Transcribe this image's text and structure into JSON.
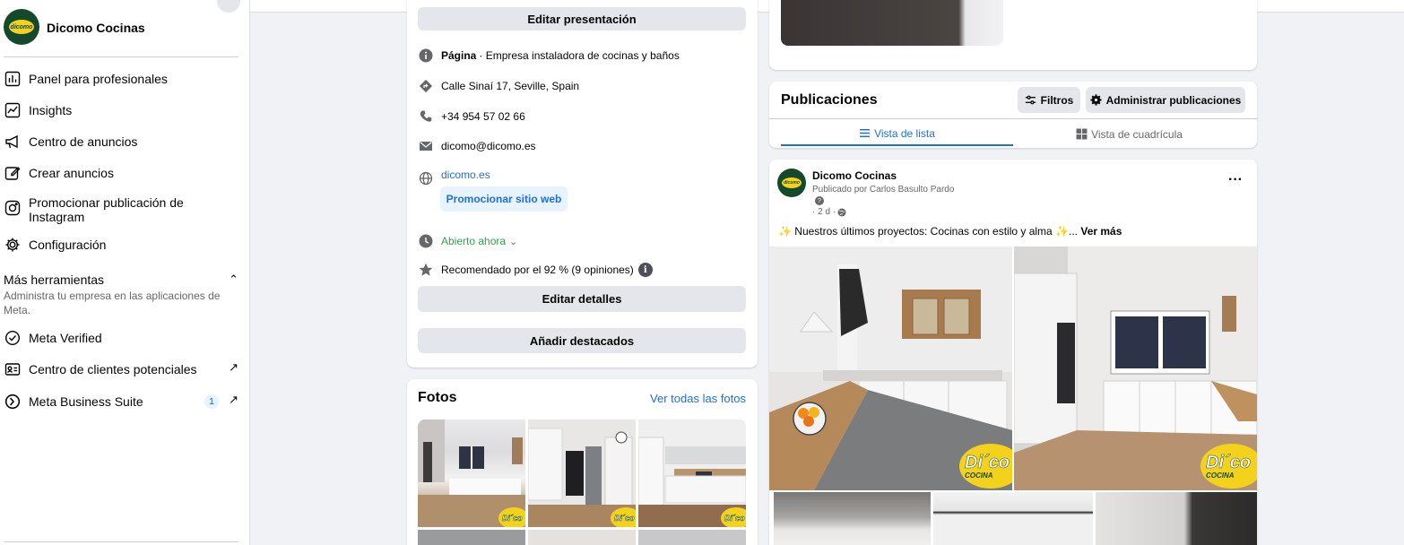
{
  "colors": {
    "accent": "#216fdb",
    "brand_green": "#14492c",
    "brand_yellow": "#f4d21c",
    "open_green": "#31a24c"
  },
  "sidebar": {
    "page_name": "Dicomo Cocinas",
    "items": [
      {
        "label": "Panel para profesionales",
        "icon": "dashboard-icon"
      },
      {
        "label": "Insights",
        "icon": "insights-icon"
      },
      {
        "label": "Centro de anuncios",
        "icon": "megaphone-icon"
      },
      {
        "label": "Crear anuncios",
        "icon": "edit-icon"
      },
      {
        "label": "Promocionar publicación de Instagram",
        "icon": "instagram-icon"
      },
      {
        "label": "Configuración",
        "icon": "gear-icon"
      }
    ],
    "more_tools": {
      "title": "Más herramientas",
      "description": "Administra tu empresa en las aplicaciones de Meta."
    },
    "tools": [
      {
        "label": "Meta Verified",
        "icon": "verified-icon"
      },
      {
        "label": "Centro de clientes potenciales",
        "icon": "leads-icon",
        "external": "↗"
      },
      {
        "label": "Meta Business Suite",
        "icon": "business-suite-icon",
        "badge": "1",
        "external": "↗"
      }
    ]
  },
  "intro": {
    "edit_presentation": "Editar presentación",
    "page_label": "Página",
    "page_category": "· Empresa instaladora de cocinas y baños",
    "address": "Calle Sinaí 17, Seville, Spain",
    "phone": "+34 954 57 02 66",
    "email": "dicomo@dicomo.es",
    "website": "dicomo.es",
    "promote_website": "Promocionar sitio web",
    "hours": "Abierto ahora",
    "rating": "Recomendado por el 92 % (9 opiniones)",
    "edit_details": "Editar detalles",
    "add_featured": "Añadir destacados"
  },
  "photos": {
    "title": "Fotos",
    "see_all": "Ver todas las fotos",
    "watermark": "Di´co",
    "watermark_sub": "COCINAS"
  },
  "publications": {
    "title": "Publicaciones",
    "filters": "Filtros",
    "manage": "Administrar publicaciones",
    "tab_list": "Vista de lista",
    "tab_grid": "Vista de cuadrícula"
  },
  "post": {
    "author": "Dicomo Cocinas",
    "published_by": "Publicado por Carlos Basulto Pardo",
    "time": "· 2 d ·",
    "more": "···",
    "text": "✨ Nuestros últimos proyectos: Cocinas con estilo y alma ✨...",
    "see_more": "Ver más",
    "watermark": "Di´co",
    "watermark_sub": "COCINA"
  }
}
